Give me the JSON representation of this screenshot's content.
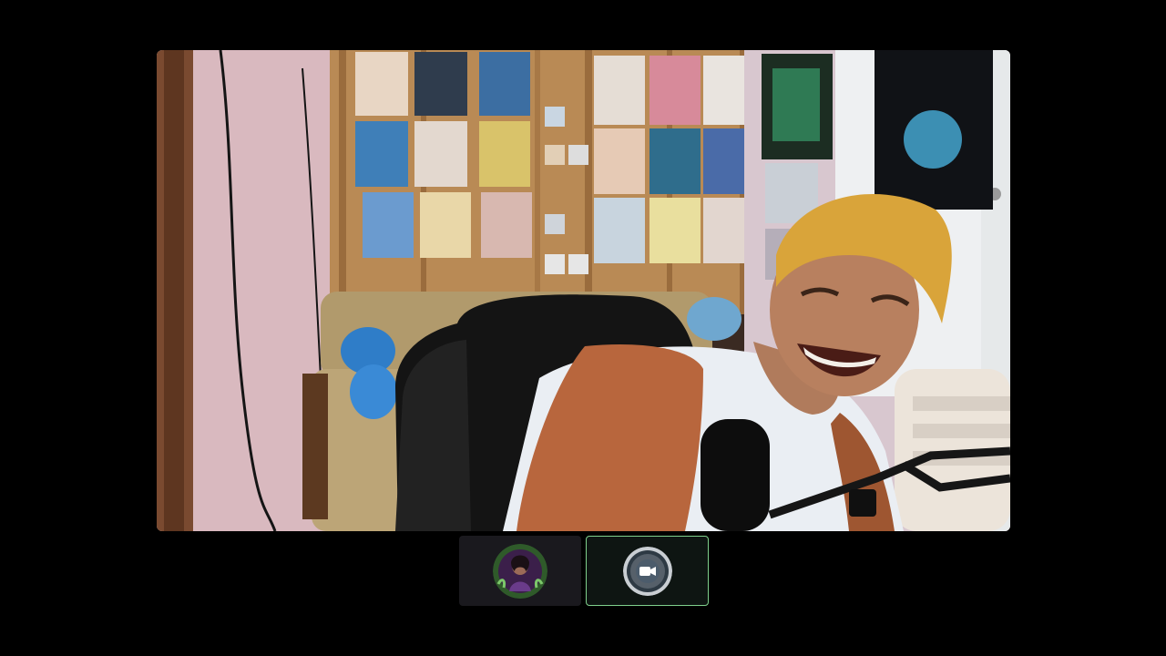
{
  "colors": {
    "background": "#000000",
    "active_tile_border": "#7fd08c",
    "thumb_background": "#1a191e"
  },
  "main_video": {
    "description_icon": "participant-video-feed"
  },
  "participants": [
    {
      "icon": "user-avatar-icon",
      "state": "avatar"
    },
    {
      "icon": "video-camera-icon",
      "state": "active-speaker"
    }
  ]
}
